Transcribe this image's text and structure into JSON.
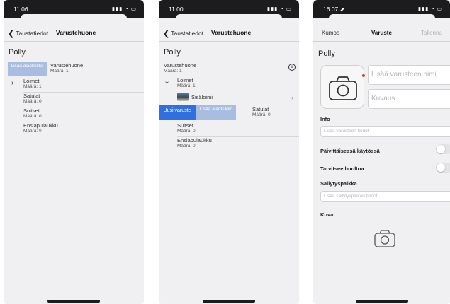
{
  "screen1": {
    "status": {
      "time": "11.06",
      "signal": "▮▮▮ ◔ ▭"
    },
    "nav": {
      "back_label": "Taustatiedot",
      "title": "Varustehuone"
    },
    "heading": "Polly",
    "swipe_action": "Lisää alaotsikko",
    "top_item": {
      "name": "Varustehuone",
      "count": "Määrä: 1"
    },
    "items": [
      {
        "name": "Loimet",
        "count": "Määrä: 1"
      },
      {
        "name": "Satulat",
        "count": "Määrä: 0"
      },
      {
        "name": "Suitset",
        "count": "Määrä: 0"
      },
      {
        "name": "Ensiapulaukku",
        "count": "Määrä: 0"
      }
    ]
  },
  "screen2": {
    "status": {
      "time": "11.00",
      "signal": "▮▮▮ ◔ ▭"
    },
    "nav": {
      "back_label": "Taustatiedot",
      "title": "Varustehuone"
    },
    "heading": "Polly",
    "top_item": {
      "name": "Varustehuone",
      "count": "Määrä: 1"
    },
    "loimet": {
      "name": "Loimet",
      "count": "Määrä: 1"
    },
    "child": {
      "name": "Sisäloimi"
    },
    "swipe_new": "Uusi varuste",
    "swipe_add": "Lisää alaotsikko",
    "satulat": {
      "name": "Satulat",
      "count": "Määrä: 0"
    },
    "suitset": {
      "name": "Suitset",
      "count": "Määrä: 0"
    },
    "ensiapu": {
      "name": "Ensiapulaukku",
      "count": "Määrä: 0"
    }
  },
  "screen3": {
    "status": {
      "time": "16.07 ⬈",
      "signal": "▮▮▮ ◔ ▭"
    },
    "nav": {
      "cancel": "Kumoa",
      "title": "Varuste",
      "save": "Tallenna"
    },
    "heading": "Polly",
    "name_placeholder": "Lisää varusteen nimi",
    "desc_placeholder": "Kuvaus",
    "info_label": "Info",
    "info_placeholder": "Lisää varusteen tiedot",
    "daily_label": "Päivittäisessä käytössä",
    "maintenance_label": "Tarvitsee huoltoa",
    "storage_label": "Säilytyspaikka",
    "storage_placeholder": "Lisää säilytyspaikan tiedot",
    "images_label": "Kuvat"
  }
}
